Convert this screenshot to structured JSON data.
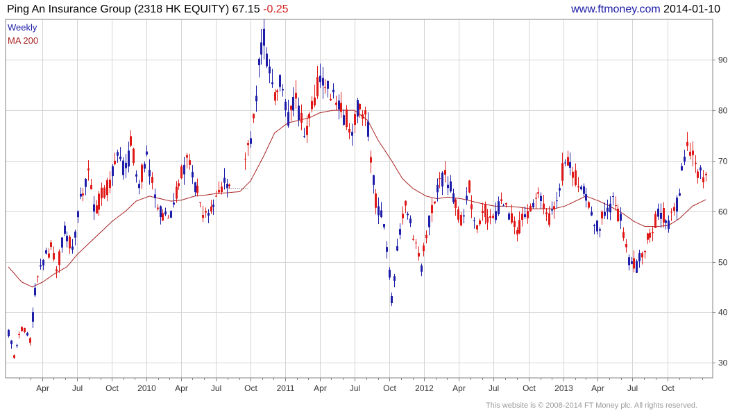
{
  "header": {
    "instrument": "Ping An Insurance Group (2318 HK EQUITY)",
    "last_price": "67.15",
    "change": "-0.25",
    "site": "www.ftmoney.com",
    "date": "2014-01-10"
  },
  "footer": {
    "copyright": "This website is © 2008-2014 FT Money plc. All rights reserved."
  },
  "colors": {
    "up": "#1d1daa",
    "down": "#e01818",
    "ma": "#a82020",
    "grid": "#d4d4d4",
    "axis": "#808080"
  },
  "chart_data": {
    "type": "candlestick",
    "legend": [
      {
        "name": "Weekly",
        "color": "#1d1daa"
      },
      {
        "name": "MA 200",
        "color": "#a82020"
      }
    ],
    "ylim": [
      27,
      98
    ],
    "y_ticks": [
      30,
      40,
      50,
      60,
      70,
      80,
      90
    ],
    "x_ticks": [
      "Apr",
      "Jul",
      "Oct",
      "2010",
      "Apr",
      "Jul",
      "Oct",
      "2011",
      "Apr",
      "Jul",
      "Oct",
      "2012",
      "Apr",
      "Jul",
      "Oct",
      "2013",
      "Apr",
      "Jul",
      "Oct"
    ],
    "x_range": [
      "2009-01-02",
      "2014-01-10"
    ],
    "grid": true,
    "legend_position": "top-left",
    "price_path": [
      [
        "2009-01-02",
        36
      ],
      [
        "2009-01-16",
        31
      ],
      [
        "2009-02-06",
        37
      ],
      [
        "2009-02-27",
        34
      ],
      [
        "2009-03-13",
        44
      ],
      [
        "2009-04-03",
        50
      ],
      [
        "2009-04-24",
        53
      ],
      [
        "2009-05-08",
        48
      ],
      [
        "2009-05-29",
        56
      ],
      [
        "2009-06-19",
        53
      ],
      [
        "2009-07-10",
        62
      ],
      [
        "2009-07-31",
        68
      ],
      [
        "2009-08-14",
        60
      ],
      [
        "2009-09-04",
        63
      ],
      [
        "2009-09-25",
        66
      ],
      [
        "2009-10-16",
        70
      ],
      [
        "2009-11-06",
        68
      ],
      [
        "2009-11-20",
        73
      ],
      [
        "2009-12-11",
        66
      ],
      [
        "2010-01-01",
        70
      ],
      [
        "2010-01-22",
        63
      ],
      [
        "2010-02-12",
        59
      ],
      [
        "2010-03-05",
        60
      ],
      [
        "2010-03-26",
        66
      ],
      [
        "2010-04-16",
        70
      ],
      [
        "2010-05-07",
        65
      ],
      [
        "2010-05-28",
        60
      ],
      [
        "2010-06-18",
        60
      ],
      [
        "2010-07-09",
        64
      ],
      [
        "2010-07-30",
        66
      ],
      [
        "2010-08-13",
        63.8
      ],
      [
        "2010-09-03",
        63.8
      ],
      [
        "2010-09-17",
        70
      ],
      [
        "2010-10-08",
        78
      ],
      [
        "2010-10-22",
        88
      ],
      [
        "2010-11-05",
        94
      ],
      [
        "2010-11-19",
        88
      ],
      [
        "2010-12-03",
        83
      ],
      [
        "2010-12-17",
        85
      ],
      [
        "2011-01-07",
        78
      ],
      [
        "2011-01-28",
        82
      ],
      [
        "2011-02-18",
        75
      ],
      [
        "2011-03-11",
        80
      ],
      [
        "2011-04-01",
        87
      ],
      [
        "2011-04-22",
        84
      ],
      [
        "2011-05-13",
        81
      ],
      [
        "2011-06-03",
        79
      ],
      [
        "2011-06-24",
        76
      ],
      [
        "2011-07-15",
        82
      ],
      [
        "2011-08-05",
        76
      ],
      [
        "2011-08-26",
        62
      ],
      [
        "2011-09-16",
        57
      ],
      [
        "2011-10-07",
        43
      ],
      [
        "2011-10-21",
        52
      ],
      [
        "2011-11-11",
        62
      ],
      [
        "2011-12-02",
        56
      ],
      [
        "2011-12-23",
        49
      ],
      [
        "2012-01-13",
        58
      ],
      [
        "2012-02-03",
        64
      ],
      [
        "2012-02-24",
        67
      ],
      [
        "2012-03-16",
        63
      ],
      [
        "2012-04-06",
        58
      ],
      [
        "2012-04-27",
        65
      ],
      [
        "2012-05-18",
        56
      ],
      [
        "2012-06-08",
        60
      ],
      [
        "2012-06-29",
        58
      ],
      [
        "2012-07-20",
        62
      ],
      [
        "2012-08-10",
        60
      ],
      [
        "2012-08-31",
        56
      ],
      [
        "2012-09-21",
        59
      ],
      [
        "2012-10-12",
        61
      ],
      [
        "2012-11-02",
        63
      ],
      [
        "2012-11-23",
        58
      ],
      [
        "2012-12-14",
        63
      ],
      [
        "2013-01-04",
        70
      ],
      [
        "2013-01-25",
        68
      ],
      [
        "2013-02-15",
        64
      ],
      [
        "2013-03-08",
        62
      ],
      [
        "2013-03-29",
        57
      ],
      [
        "2013-04-19",
        59
      ],
      [
        "2013-05-10",
        62
      ],
      [
        "2013-05-31",
        58
      ],
      [
        "2013-06-21",
        50
      ],
      [
        "2013-07-12",
        49
      ],
      [
        "2013-08-02",
        53
      ],
      [
        "2013-08-23",
        57
      ],
      [
        "2013-09-13",
        60
      ],
      [
        "2013-10-04",
        58
      ],
      [
        "2013-10-25",
        61
      ],
      [
        "2013-11-08",
        68
      ],
      [
        "2013-11-22",
        74
      ],
      [
        "2013-12-06",
        72
      ],
      [
        "2013-12-20",
        68
      ],
      [
        "2014-01-10",
        67.15
      ]
    ],
    "ma_200_path": [
      [
        "2009-01-02",
        49
      ],
      [
        "2009-02-06",
        46
      ],
      [
        "2009-03-06",
        45
      ],
      [
        "2009-04-03",
        46
      ],
      [
        "2009-05-01",
        47.5
      ],
      [
        "2009-06-05",
        49
      ],
      [
        "2009-07-03",
        51.5
      ],
      [
        "2009-08-07",
        54
      ],
      [
        "2009-09-04",
        56
      ],
      [
        "2009-10-02",
        58
      ],
      [
        "2009-11-06",
        60
      ],
      [
        "2009-12-04",
        62
      ],
      [
        "2010-01-08",
        63
      ],
      [
        "2010-02-05",
        62.5
      ],
      [
        "2010-03-05",
        62
      ],
      [
        "2010-04-02",
        62.2
      ],
      [
        "2010-05-07",
        63
      ],
      [
        "2010-06-04",
        63.2
      ],
      [
        "2010-07-02",
        63.5
      ],
      [
        "2010-08-06",
        63.7
      ],
      [
        "2010-09-03",
        63.9
      ],
      [
        "2010-10-01",
        66
      ],
      [
        "2010-11-05",
        71
      ],
      [
        "2010-12-03",
        75.5
      ],
      [
        "2011-01-07",
        77.5
      ],
      [
        "2011-02-04",
        78
      ],
      [
        "2011-03-04",
        78.5
      ],
      [
        "2011-04-01",
        79.5
      ],
      [
        "2011-05-06",
        80
      ],
      [
        "2011-06-03",
        80
      ],
      [
        "2011-07-01",
        80
      ],
      [
        "2011-08-05",
        78
      ],
      [
        "2011-09-02",
        74
      ],
      [
        "2011-10-07",
        70
      ],
      [
        "2011-11-04",
        66.5
      ],
      [
        "2011-12-02",
        64.5
      ],
      [
        "2012-01-06",
        63
      ],
      [
        "2012-02-03",
        62.5
      ],
      [
        "2012-03-02",
        62.8
      ],
      [
        "2012-04-06",
        62.5
      ],
      [
        "2012-05-04",
        62
      ],
      [
        "2012-06-01",
        61.5
      ],
      [
        "2012-07-06",
        61
      ],
      [
        "2012-08-03",
        61
      ],
      [
        "2012-09-07",
        60.8
      ],
      [
        "2012-10-05",
        60.5
      ],
      [
        "2012-11-02",
        60.5
      ],
      [
        "2012-12-07",
        60.5
      ],
      [
        "2013-01-04",
        61
      ],
      [
        "2013-02-01",
        62
      ],
      [
        "2013-03-01",
        63
      ],
      [
        "2013-04-05",
        62
      ],
      [
        "2013-05-03",
        61
      ],
      [
        "2013-06-07",
        59.5
      ],
      [
        "2013-07-05",
        58
      ],
      [
        "2013-08-02",
        57
      ],
      [
        "2013-09-06",
        57
      ],
      [
        "2013-10-04",
        57.2
      ],
      [
        "2013-11-01",
        58.5
      ],
      [
        "2013-12-06",
        61
      ],
      [
        "2014-01-10",
        62.3
      ]
    ],
    "gap_marker": {
      "from": "2010-07-30",
      "to": "2010-09-24",
      "value": 64.5
    }
  }
}
